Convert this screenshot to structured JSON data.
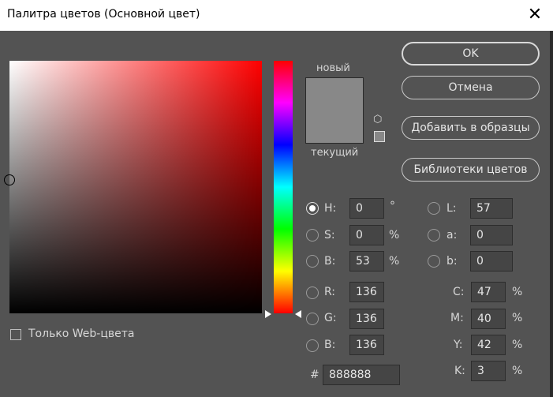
{
  "window": {
    "title": "Палитра цветов (Основной цвет)",
    "close_glyph": "✕"
  },
  "preview": {
    "new_label": "новый",
    "current_label": "текущий",
    "new_color": "#888888",
    "current_color": "#888888"
  },
  "buttons": {
    "ok": "OK",
    "cancel": "Отмена",
    "add_swatch": "Добавить в образцы",
    "libraries": "Библиотеки цветов"
  },
  "hsb": [
    {
      "label": "H:",
      "value": "0",
      "unit": "°",
      "selected": true
    },
    {
      "label": "S:",
      "value": "0",
      "unit": "%",
      "selected": false
    },
    {
      "label": "B:",
      "value": "53",
      "unit": "%",
      "selected": false
    }
  ],
  "rgb": [
    {
      "label": "R:",
      "value": "136"
    },
    {
      "label": "G:",
      "value": "136"
    },
    {
      "label": "B:",
      "value": "136"
    }
  ],
  "lab": [
    {
      "label": "L:",
      "value": "57"
    },
    {
      "label": "a:",
      "value": "0"
    },
    {
      "label": "b:",
      "value": "0"
    }
  ],
  "cmyk": [
    {
      "label": "C:",
      "value": "47",
      "unit": "%"
    },
    {
      "label": "M:",
      "value": "40",
      "unit": "%"
    },
    {
      "label": "Y:",
      "value": "42",
      "unit": "%"
    },
    {
      "label": "K:",
      "value": "3",
      "unit": "%"
    }
  ],
  "hex": {
    "label": "#",
    "value": "888888"
  },
  "web_only": {
    "label": "Только Web-цвета",
    "checked": false
  }
}
